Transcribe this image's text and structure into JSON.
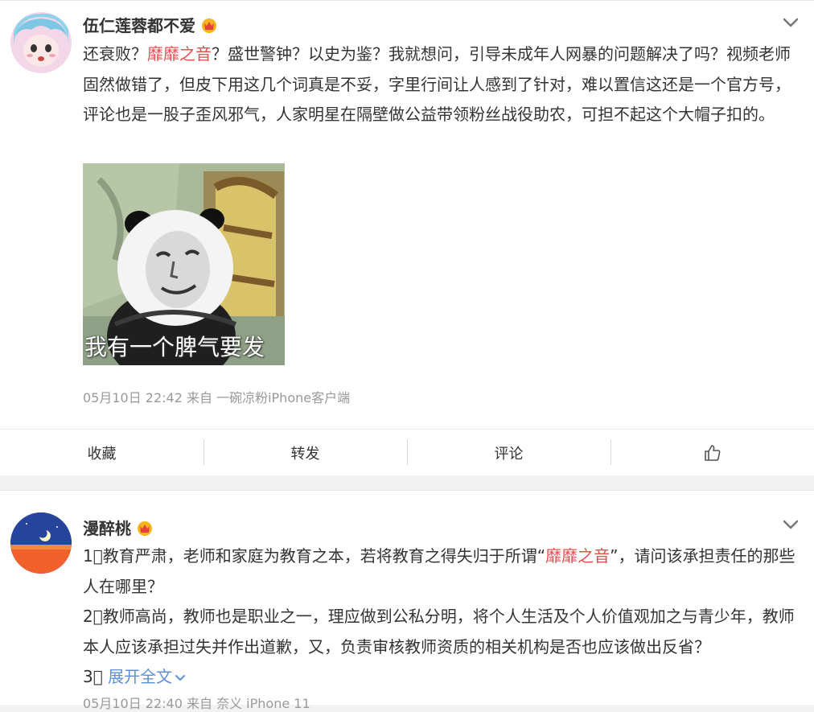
{
  "post1": {
    "username": "伍仁莲蓉都不爱",
    "text_segments": [
      "还衰败？",
      "靡靡之音",
      "？盛世警钟？以史为鉴？我就想问，引导未成年人网暴的问题解决了吗？视频老师固然做错了，但皮下用这几个词真是不妥，字里行间让人感到了针对，难以置信这还是一个官方号，评论也是一股子歪风邪气，人家明星在隔壁做公益带领粉丝战役助农，可担不起这个大帽子扣的。"
    ],
    "meme_caption": "我有一个脾气要发",
    "meta": "05月10日 22:42  来自 一碗凉粉iPhone客户端"
  },
  "actions": {
    "collect": "收藏",
    "repost": "转发",
    "comment": "评论"
  },
  "post2": {
    "username": "漫醉桃",
    "line1_a": "1\u0000教育严肃，老师和家庭为教育之本，若将教育之得失归于所谓“",
    "line1_hl": "靡靡之音",
    "line1_b": "”，请问该承担责任的那些人在哪里？",
    "line2": "2\u0000教师高尚，教师也是职业之一，理应做到公私分明，将个人生活及个人价值观加之与青少年，教师本人应该承担过失并作出道歉，又，负责审核教师资质的相关机构是否也应该做出反省？",
    "line3_prefix": "3\u0000",
    "expand": "展开全文",
    "meta": "05月10日 22:40  来自 奈义 iPhone 11"
  },
  "icons": {
    "crown": "crown-icon",
    "chevron": "chevron-down-icon",
    "thumb": "thumbs-up-icon"
  },
  "colors": {
    "highlight": "#e0504d",
    "link": "#5d8fd8"
  }
}
